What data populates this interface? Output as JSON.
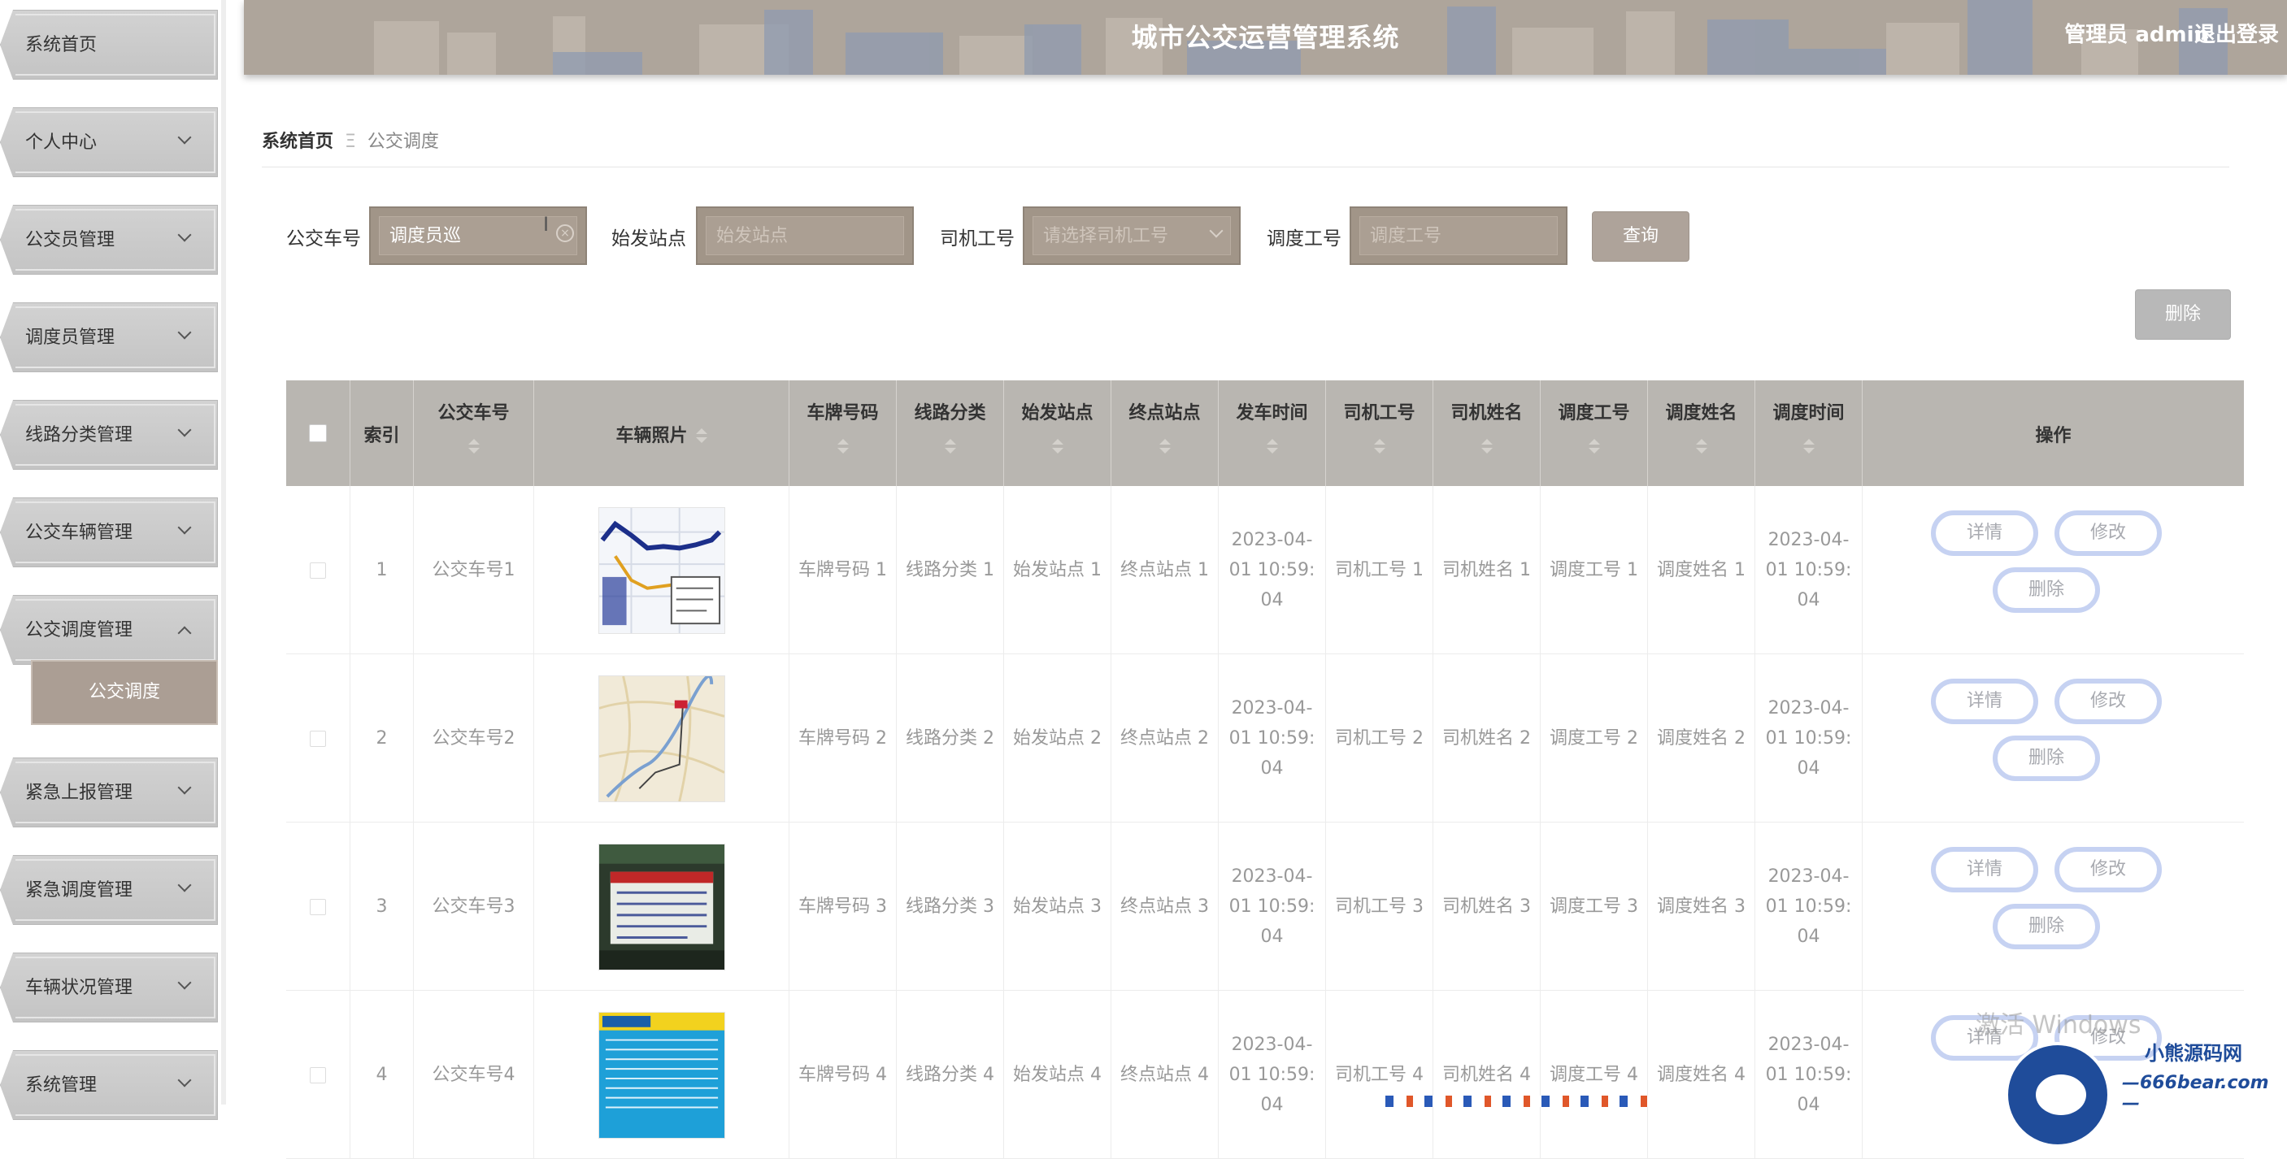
{
  "sidebar": {
    "items": [
      {
        "label": "系统首页",
        "has_chevron": false
      },
      {
        "label": "个人中心",
        "has_chevron": true
      },
      {
        "label": "公交员管理",
        "has_chevron": true
      },
      {
        "label": "调度员管理",
        "has_chevron": true
      },
      {
        "label": "线路分类管理",
        "has_chevron": true
      },
      {
        "label": "公交车辆管理",
        "has_chevron": true
      },
      {
        "label": "公交调度管理",
        "has_chevron": true,
        "expanded": true
      },
      {
        "label": "紧急上报管理",
        "has_chevron": true
      },
      {
        "label": "紧急调度管理",
        "has_chevron": true
      },
      {
        "label": "车辆状况管理",
        "has_chevron": true
      },
      {
        "label": "系统管理",
        "has_chevron": true
      }
    ],
    "active_subitem": "公交调度"
  },
  "header": {
    "title": "城市公交运营管理系统",
    "user": "管理员 admin",
    "logout": "退出登录"
  },
  "breadcrumb": {
    "home": "系统首页",
    "separator": "Ξ",
    "current": "公交调度"
  },
  "filter": {
    "bus_no_label": "公交车号",
    "bus_no_value": "调度员巡",
    "start_station_label": "始发站点",
    "start_station_placeholder": "始发站点",
    "driver_no_label": "司机工号",
    "driver_no_placeholder": "请选择司机工号",
    "dispatch_no_label": "调度工号",
    "dispatch_no_placeholder": "调度工号",
    "query_button": "查询",
    "delete_button": "删除"
  },
  "table": {
    "headers": {
      "index": "索引",
      "bus_no": "公交车号",
      "photo": "车辆照片",
      "plate": "车牌号码",
      "route_category": "线路分类",
      "start_station": "始发站点",
      "end_station": "终点站点",
      "depart_time": "发车时间",
      "driver_no": "司机工号",
      "driver_name": "司机姓名",
      "dispatch_no": "调度工号",
      "dispatch_name": "调度姓名",
      "dispatch_time": "调度时间",
      "actions": "操作"
    },
    "action_labels": {
      "detail": "详情",
      "edit": "修改",
      "delete": "删除"
    },
    "rows": [
      {
        "index": "1",
        "bus_no": "公交车号1",
        "plate": "车牌号码 1",
        "route_category": "线路分类 1",
        "start_station": "始发站点 1",
        "end_station": "终点站点 1",
        "depart_time": "2023-04- 01 10:59: 04",
        "driver_no": "司机工号 1",
        "driver_name": "司机姓名 1",
        "dispatch_no": "调度工号 1",
        "dispatch_name": "调度姓名 1",
        "dispatch_time": "2023-04- 01 10:59: 04",
        "photo_icon": "route-map-photo"
      },
      {
        "index": "2",
        "bus_no": "公交车号2",
        "plate": "车牌号码 2",
        "route_category": "线路分类 2",
        "start_station": "始发站点 2",
        "end_station": "终点站点 2",
        "depart_time": "2023-04- 01 10:59: 04",
        "driver_no": "司机工号 2",
        "driver_name": "司机姓名 2",
        "dispatch_no": "调度工号 2",
        "dispatch_name": "调度姓名 2",
        "dispatch_time": "2023-04- 01 10:59: 04",
        "photo_icon": "city-map-photo"
      },
      {
        "index": "3",
        "bus_no": "公交车号3",
        "plate": "车牌号码 3",
        "route_category": "线路分类 3",
        "start_station": "始发站点 3",
        "end_station": "终点站点 3",
        "depart_time": "2023-04- 01 10:59: 04",
        "driver_no": "司机工号 3",
        "driver_name": "司机姓名 3",
        "dispatch_no": "调度工号 3",
        "dispatch_name": "调度姓名 3",
        "dispatch_time": "2023-04- 01 10:59: 04",
        "photo_icon": "bus-sign-photo"
      },
      {
        "index": "4",
        "bus_no": "公交车号4",
        "plate": "车牌号码 4",
        "route_category": "线路分类 4",
        "start_station": "始发站点 4",
        "end_station": "终点站点 4",
        "depart_time": "2023-04- 01 10:59: 04",
        "driver_no": "司机工号 4",
        "driver_name": "司机姓名 4",
        "dispatch_no": "调度工号 4",
        "dispatch_name": "调度姓名 4",
        "dispatch_time": "2023-04- 01 10:59: 04",
        "photo_icon": "bus-route-board-photo"
      }
    ]
  },
  "overlay": {
    "activate_windows": "激活 Windows",
    "watermark_name": "小熊源码网",
    "watermark_url": "—666bear.com—"
  },
  "colors": {
    "header_bg": "#aea59b",
    "active_submenu": "#ab9e94",
    "filter_box": "#a19588",
    "table_head": "#b9b6b1",
    "op_button_border": "#c6d2f2"
  }
}
